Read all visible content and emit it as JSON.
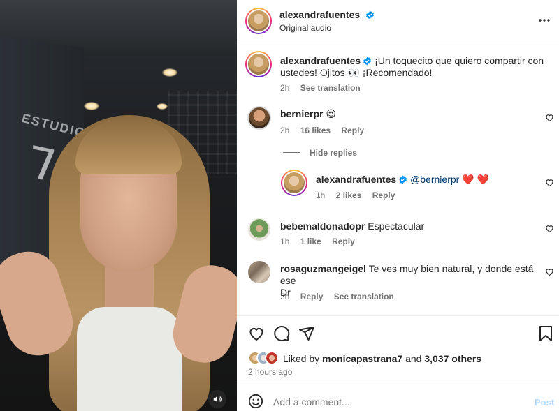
{
  "post": {
    "author": "alexandrafuentes",
    "audio": "Original audio",
    "caption_user": "alexandrafuentes",
    "caption_line1": "¡Un toquecito que quiero compartir con",
    "caption_line2": "ustedes! Ojitos 👀 ¡Recomendado!",
    "caption_time": "2h",
    "caption_translation": "See translation"
  },
  "comments": [
    {
      "user": "bernierpr",
      "text": "😍",
      "time": "2h",
      "likes": "16 likes",
      "reply": "Reply",
      "hide_replies": "Hide replies",
      "replies": [
        {
          "user": "alexandrafuentes",
          "mention": "@bernierpr",
          "text": "❤️ ❤️",
          "time": "1h",
          "likes": "2 likes",
          "reply": "Reply"
        }
      ]
    },
    {
      "user": "bebemaldonadopr",
      "text": "Espectacular",
      "time": "1h",
      "likes": "1 like",
      "reply": "Reply"
    },
    {
      "user": "rosaguzmangeigel",
      "text_line1": "Te ves muy bien natural, y donde está ese",
      "text_line2": "Dr",
      "time": "2h",
      "reply": "Reply",
      "translation": "See translation"
    }
  ],
  "likes": {
    "prefix": "Liked by",
    "user": "monicapastrana7",
    "and": "and",
    "others": "3,037 others"
  },
  "posted_ago": "2 hours ago",
  "composer": {
    "placeholder": "Add a comment...",
    "post_label": "Post"
  },
  "video": {
    "studio_text": "ESTUDIO",
    "studio_number": "7"
  },
  "colors": {
    "verified": "#0095f6",
    "link": "#00376b",
    "muted": "#737373",
    "post_disabled": "#b3dbff"
  }
}
